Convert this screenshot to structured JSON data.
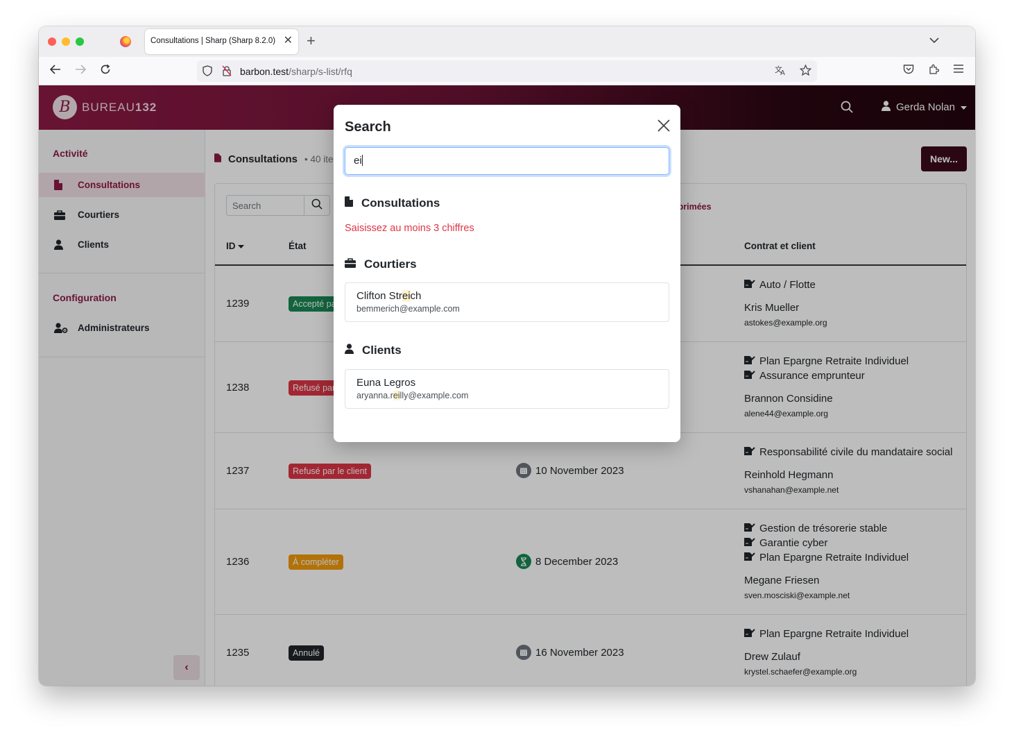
{
  "browser": {
    "tab_title": "Consultations | Sharp (Sharp 8.2.0)",
    "url_host": "barbon.test",
    "url_path": "/sharp/s-list/rfq"
  },
  "app": {
    "brand_light": "BUREAU",
    "brand_bold": "132",
    "brand_monogram": "B",
    "user_name": "Gerda Nolan"
  },
  "sidebar": {
    "heading_activity": "Activité",
    "items_activity": [
      "Consultations",
      "Courtiers",
      "Clients"
    ],
    "heading_config": "Configuration",
    "items_config": [
      "Administrateurs"
    ],
    "collapse_icon": "chevron-left-icon"
  },
  "list": {
    "title": "Consultations",
    "count": "40 ite",
    "new_button": "New...",
    "search_placeholder": "Search",
    "deleted_filter": "pprimées",
    "columns": {
      "id": "ID",
      "state": "État",
      "contract": "Contrat et client"
    },
    "rows": [
      {
        "id": "1239",
        "state": "Accepté pa",
        "date": "",
        "contracts": [
          "Auto / Flotte"
        ],
        "client": "Kris Mueller",
        "email": "astokes@example.org"
      },
      {
        "id": "1238",
        "state": "Refusé par",
        "date": "",
        "contracts": [
          "Plan Epargne Retraite Individuel",
          "Assurance emprunteur"
        ],
        "client": "Brannon Considine",
        "email": "alene44@example.org"
      },
      {
        "id": "1237",
        "state": "Refusé par le client",
        "date": "10 November 2023",
        "contracts": [
          "Responsabilité civile du mandataire social"
        ],
        "client": "Reinhold Hegmann",
        "email": "vshanahan@example.net"
      },
      {
        "id": "1236",
        "state": "À compléter",
        "date": "8 December 2023",
        "contracts": [
          "Gestion de trésorerie stable",
          "Garantie cyber",
          "Plan Epargne Retraite Individuel"
        ],
        "client": "Megane Friesen",
        "email": "sven.mosciski@example.net"
      },
      {
        "id": "1235",
        "state": "Annulé",
        "date": "16 November 2023",
        "contracts": [
          "Plan Epargne Retraite Individuel"
        ],
        "client": "Drew Zulauf",
        "email": "krystel.schaefer@example.org"
      }
    ]
  },
  "modal": {
    "title": "Search",
    "query": "ei",
    "sections": {
      "consultations": {
        "title": "Consultations",
        "error": "Saisissez au moins 3 chiffres"
      },
      "courtiers": {
        "title": "Courtiers",
        "result_name_before": "Clifton Str",
        "result_name_match": "ei",
        "result_name_after": "ch",
        "result_email": "bemmerich@example.com"
      },
      "clients": {
        "title": "Clients",
        "result_name": "Euna Legros",
        "result_email_before": "aryanna.r",
        "result_email_match": "ei",
        "result_email_after": "lly@example.com"
      }
    }
  },
  "colors": {
    "brand": "#8d1a45",
    "brand_dark": "#3a0a1b",
    "success": "#198754",
    "danger": "#dc3545",
    "warning": "#f09a0d",
    "dark": "#212529"
  }
}
